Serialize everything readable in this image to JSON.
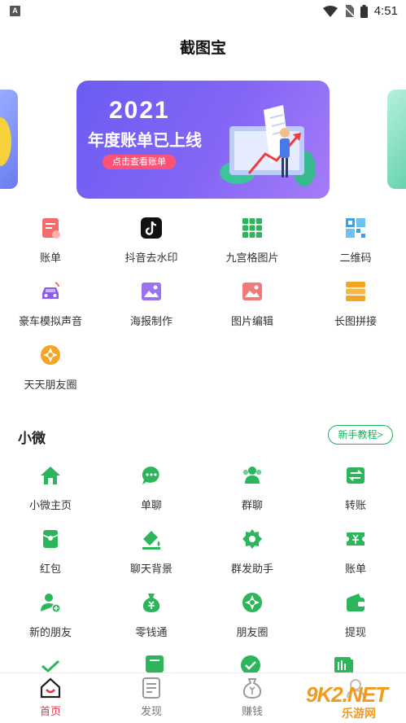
{
  "status": {
    "badge": "A",
    "time": "4:51"
  },
  "header": {
    "title": "截图宝"
  },
  "banner": {
    "year": "2021",
    "headline": "年度账单已上线",
    "button_label": "点击查看账单"
  },
  "tools": [
    {
      "label": "账单",
      "icon": "bill-icon"
    },
    {
      "label": "抖音去水印",
      "icon": "tiktok-icon"
    },
    {
      "label": "九宫格图片",
      "icon": "grid-nine-icon"
    },
    {
      "label": "二维码",
      "icon": "qrcode-icon"
    },
    {
      "label": "豪车模拟声音",
      "icon": "car-icon"
    },
    {
      "label": "海报制作",
      "icon": "poster-icon"
    },
    {
      "label": "图片编辑",
      "icon": "image-edit-icon"
    },
    {
      "label": "长图拼接",
      "icon": "long-image-icon"
    },
    {
      "label": "天天朋友圈",
      "icon": "moments-icon"
    }
  ],
  "section": {
    "title": "小微",
    "tutorial_label": "新手教程>"
  },
  "wechat_tools": [
    {
      "label": "小微主页",
      "icon": "home-icon"
    },
    {
      "label": "单聊",
      "icon": "chat-icon"
    },
    {
      "label": "群聊",
      "icon": "group-chat-icon"
    },
    {
      "label": "转账",
      "icon": "transfer-icon"
    },
    {
      "label": "红包",
      "icon": "red-packet-icon"
    },
    {
      "label": "聊天背景",
      "icon": "chat-background-icon"
    },
    {
      "label": "群发助手",
      "icon": "broadcast-icon"
    },
    {
      "label": "账单",
      "icon": "bill-icon"
    },
    {
      "label": "新的朋友",
      "icon": "add-friend-icon"
    },
    {
      "label": "零钱通",
      "icon": "money-bag-icon"
    },
    {
      "label": "朋友圈",
      "icon": "moments-icon"
    },
    {
      "label": "提现",
      "icon": "wallet-icon"
    }
  ],
  "tabbar": [
    {
      "label": "首页",
      "icon": "home-tab-icon",
      "active": true
    },
    {
      "label": "发现",
      "icon": "discover-tab-icon",
      "active": false
    },
    {
      "label": "赚钱",
      "icon": "earn-tab-icon",
      "active": false
    },
    {
      "label": "",
      "icon": "profile-tab-icon",
      "active": false
    }
  ],
  "watermark": {
    "text": "9K2.NET",
    "sub": "乐游网"
  },
  "colors": {
    "accent_green": "#19b35a",
    "active_red": "#e8334a",
    "banner_purple": "#7563f3"
  }
}
